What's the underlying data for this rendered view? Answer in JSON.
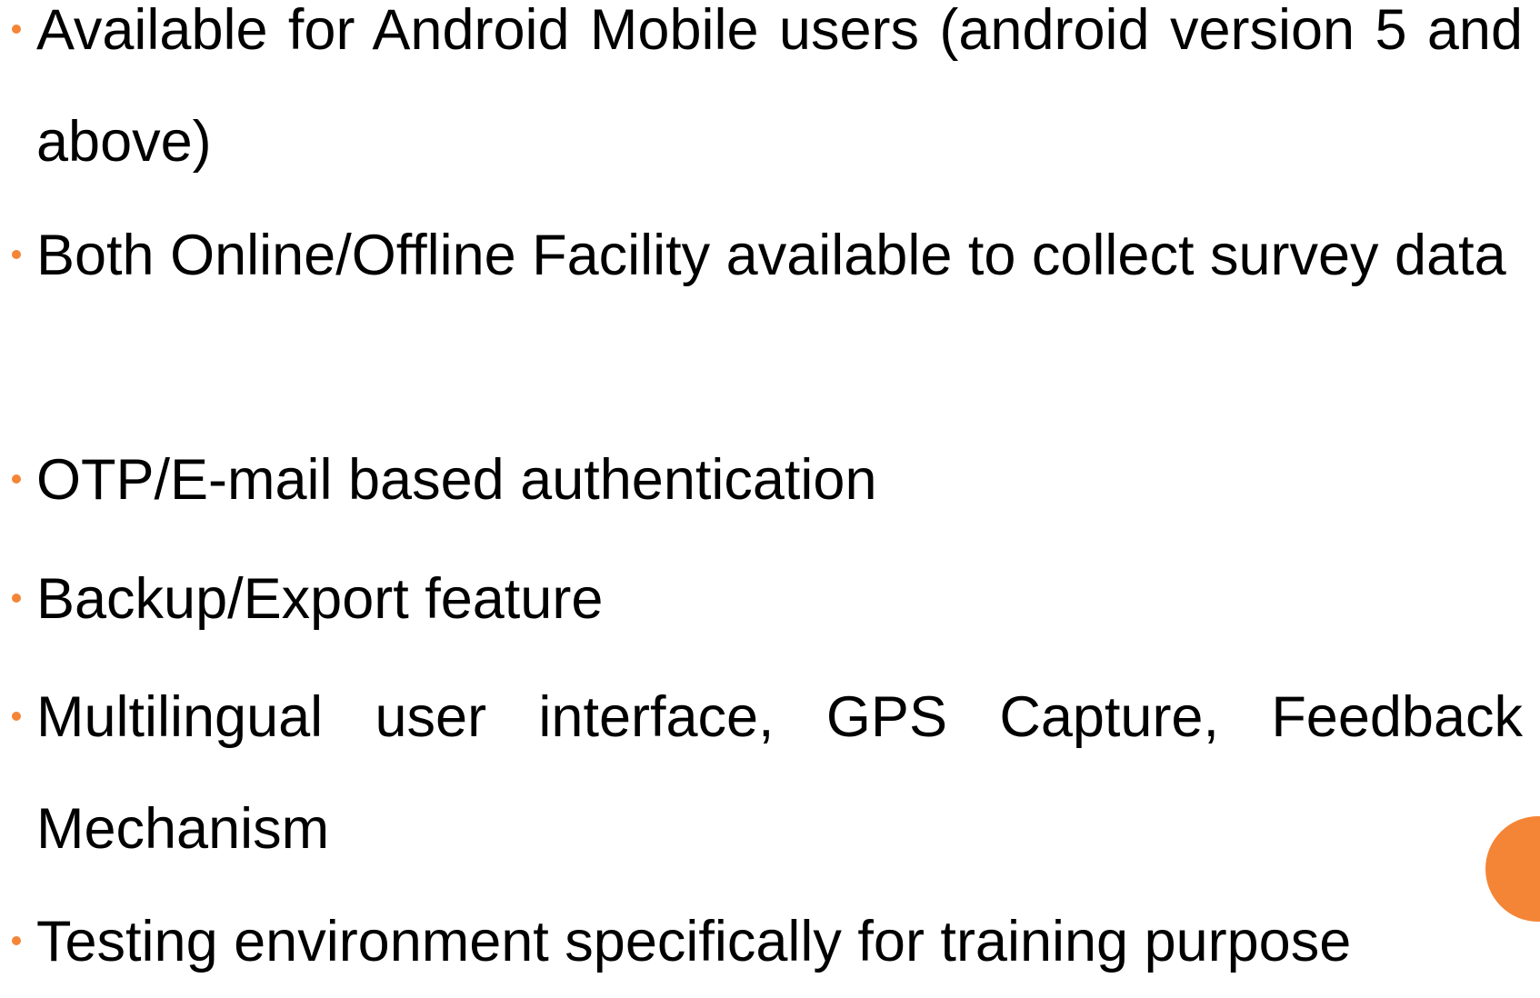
{
  "theme": {
    "bullet_color": "#F58536",
    "accent_color": "#F58536",
    "text_color": "#000000"
  },
  "bullets": [
    {
      "text": "Available for Android Mobile users (android version 5 and above)"
    },
    {
      "text": "Both Online/Offline Facility available to collect survey data"
    },
    {
      "text": "OTP/E-mail based authentication"
    },
    {
      "text": "Backup/Export feature"
    },
    {
      "text": "Multilingual user interface, GPS Capture, Feedback Mechanism"
    },
    {
      "text": "Testing environment specifically for training purpose"
    }
  ]
}
